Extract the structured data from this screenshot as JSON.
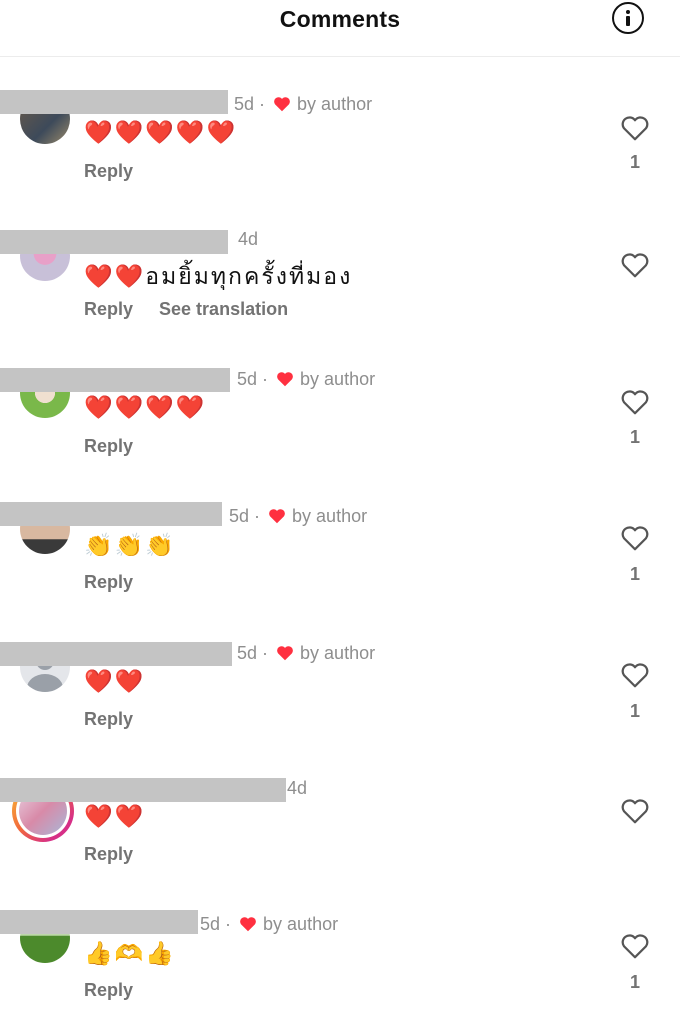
{
  "header": {
    "title": "Comments",
    "info_icon": "info-icon"
  },
  "comments": [
    {
      "time": "5d",
      "liked_by_author": true,
      "author_label": "by author",
      "text": "❤️❤️❤️❤️❤️",
      "reply": "Reply",
      "likes": "1"
    },
    {
      "time": "4d",
      "liked_by_author": false,
      "text": "❤️❤️อมยิ้มทุกครั้งที่มอง",
      "reply": "Reply",
      "translate": "See translation",
      "likes": ""
    },
    {
      "time": "5d",
      "liked_by_author": true,
      "author_label": "by author",
      "text": "❤️❤️❤️❤️",
      "reply": "Reply",
      "likes": "1"
    },
    {
      "time": "5d",
      "liked_by_author": true,
      "author_label": "by author",
      "text": "👏👏👏",
      "reply": "Reply",
      "likes": "1"
    },
    {
      "time": "5d",
      "liked_by_author": true,
      "author_label": "by author",
      "text": "❤️❤️",
      "reply": "Reply",
      "likes": "1"
    },
    {
      "time": "4d",
      "liked_by_author": false,
      "text": "❤️❤️",
      "reply": "Reply",
      "likes": ""
    },
    {
      "time": "5d",
      "liked_by_author": true,
      "author_label": "by author",
      "text": "👍🫶👍",
      "reply": "Reply",
      "likes": "1"
    }
  ],
  "colors": {
    "heart_red": "#ff3040",
    "muted_text": "#8e8e8e",
    "redaction": "#c4c4c4"
  }
}
